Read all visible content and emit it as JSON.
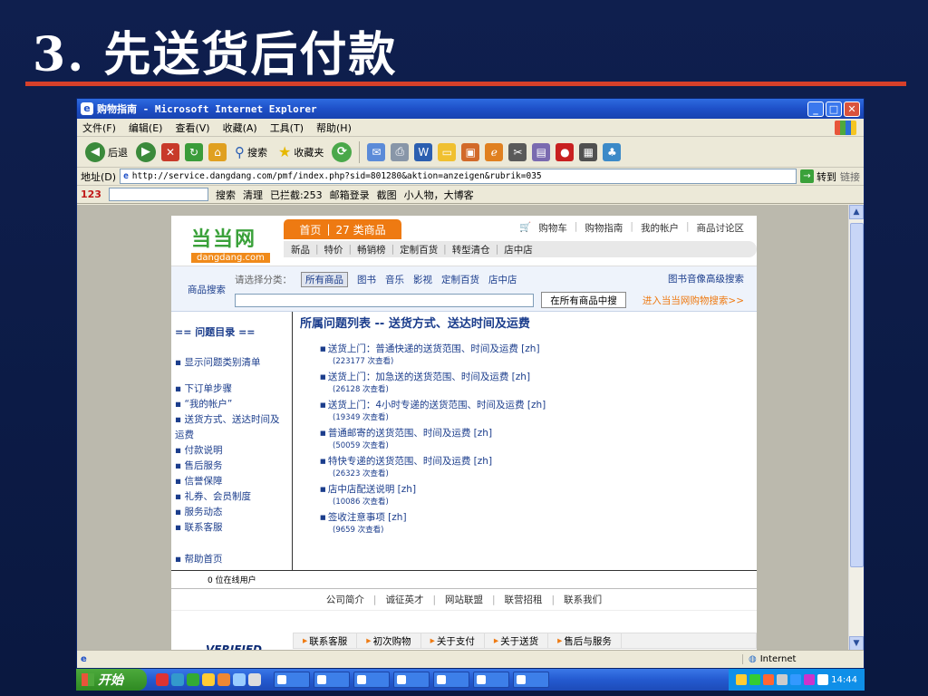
{
  "slide": {
    "title": "3. 先送货后付款"
  },
  "window": {
    "title": "购物指南 - Microsoft Internet Explorer",
    "min": "_",
    "max": "□",
    "close": "✕"
  },
  "menu": [
    "文件(F)",
    "编辑(E)",
    "查看(V)",
    "收藏(A)",
    "工具(T)",
    "帮助(H)"
  ],
  "toolbar": {
    "back": "后退",
    "search": "搜索",
    "favorites": "收藏夹"
  },
  "address": {
    "label": "地址(D)",
    "url": "http://service.dangdang.com/pmf/index.php?sid=801280&aktion=anzeigen&rubrik=035",
    "go": "转到",
    "links": "链接"
  },
  "linksbar": {
    "brand": "123",
    "search": "搜索",
    "clean": "清理",
    "blocked": "已拦截:253",
    "mail": "邮箱登录",
    "capture": "截图",
    "people": "小人物，大博客"
  },
  "site": {
    "logo_cn": "当当网",
    "logo_en": "dangdang.com",
    "home_tab": "首页",
    "cat_tab": "27 类商品",
    "top_links": [
      "购物车",
      "购物指南",
      "我的帐户",
      "商品讨论区"
    ],
    "subnav": [
      "新品",
      "特价",
      "畅销榜",
      "定制百货",
      "转型清仓",
      "店中店"
    ],
    "search": {
      "label": "商品搜索",
      "hint": "请选择分类：",
      "selected": "所有商品",
      "cats": [
        "图书",
        "音乐",
        "影视",
        "定制百货",
        "店中店"
      ],
      "button": "在所有商品中搜",
      "advanced": "图书音像高级搜索",
      "enter": "进入当当网购物搜索>>"
    },
    "sidebar": {
      "title": "== 问题目录 ==",
      "item_list": "显示问题类别清单",
      "items": [
        "下订单步骤",
        "“我的帐户”",
        "送货方式、送达时间及运费",
        "付款说明",
        "售后服务",
        "信誉保障",
        "礼券、会员制度",
        "服务动态",
        "联系客服"
      ],
      "help_home": "帮助首页"
    },
    "main": {
      "title": "所属问题列表 -- 送货方式、送达时间及运费",
      "questions": [
        {
          "text": "送货上门：普通快递的送货范围、时间及运费 [zh]",
          "count": "(223177 次查看)"
        },
        {
          "text": "送货上门：加急送的送货范围、时间及运费 [zh]",
          "count": "(26128 次查看)"
        },
        {
          "text": "送货上门：4小时专递的送货范围、时间及运费 [zh]",
          "count": "(19349 次查看)"
        },
        {
          "text": "普通邮寄的送货范围、时间及运费 [zh]",
          "count": "(50059 次查看)"
        },
        {
          "text": "特快专递的送货范围、时间及运费 [zh]",
          "count": "(26323 次查看)"
        },
        {
          "text": "店中店配送说明 [zh]",
          "count": "(10086 次查看)"
        },
        {
          "text": "签收注意事项 [zh]",
          "count": "(9659 次查看)"
        }
      ]
    },
    "online": "0 位在线用户",
    "footer_links": [
      "公司简介",
      "诚征英才",
      "网站联盟",
      "联营招租",
      "联系我们"
    ],
    "verified": "VERIFIED",
    "bottom_nav": [
      "联系客服",
      "初次购物",
      "关于支付",
      "关于送货",
      "售后与服务"
    ]
  },
  "status": {
    "zone": "Internet"
  },
  "taskbar": {
    "start": "开始",
    "clock": "14:44"
  }
}
